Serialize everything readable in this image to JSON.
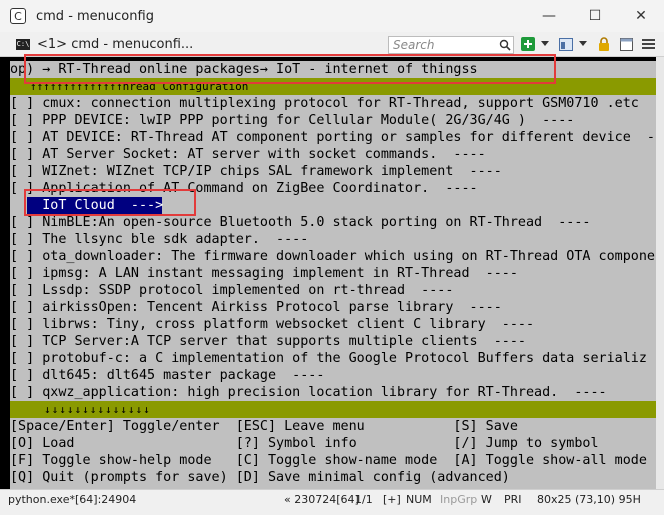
{
  "window": {
    "title": "cmd - menuconfig",
    "minimize_glyph": "—",
    "maximize_glyph": "☐",
    "close_glyph": "✕"
  },
  "tab": {
    "label": "<1> cmd - menuconfi...",
    "icon": "console-icon"
  },
  "search": {
    "placeholder": "Search"
  },
  "toolbar": {
    "icons": [
      "search-icon",
      "new-console-plus-icon",
      "dropdown-icon",
      "view-icon",
      "lock-icon",
      "window-layout-icon",
      "menu-icon"
    ]
  },
  "terminal": {
    "breadcrumb": "op) → RT-Thread online packages→ IoT - internet of thingss",
    "header_partial": "   ↑↑↑↑↑↑↑↑↑↑↑↑↑↑hread Configuration",
    "items": [
      "[ ] cmux: connection multiplexing protocol for RT-Thread, support GSM0710 .etc",
      "[ ] PPP DEVICE: lwIP PPP porting for Cellular Module( 2G/3G/4G )  ----",
      "[ ] AT DEVICE: RT-Thread AT component porting or samples for different device  -",
      "[ ] AT Server Socket: AT server with socket commands.  ----",
      "[ ] WIZnet: WIZnet TCP/IP chips SAL framework implement  ----",
      "[ ] Application of AT Command on ZigBee Coordinator.  ----",
      "    IoT Cloud  --->",
      "[ ] NimBLE:An open-source Bluetooth 5.0 stack porting on RT-Thread  ----",
      "[ ] The llsync ble sdk adapter.  ----",
      "[ ] ota_downloader: The firmware downloader which using on RT-Thread OTA compone",
      "[ ] ipmsg: A LAN instant messaging implement in RT-Thread  ----",
      "[ ] Lssdp: SSDP protocol implemented on rt-thread  ----",
      "[ ] airkissOpen: Tencent Airkiss Protocol parse library  ----",
      "[ ] librws: Tiny, cross platform websocket client C library  ----",
      "[ ] TCP Server:A TCP server that supports multiple clients  ----",
      "[ ] protobuf-c: a C implementation of the Google Protocol Buffers data serializ",
      "[ ] dlt645: dlt645 master package  ----",
      "[ ] qxwz_application: high precision location library for RT-Thread.  ----"
    ],
    "selected_index": 6,
    "scroll_down_arrows": "↓↓↓↓↓↓↓↓↓↓↓↓↓↓",
    "help_lines": [
      "[Space/Enter] Toggle/enter  [ESC] Leave menu           [S] Save",
      "[O] Load                    [?] Symbol info            [/] Jump to symbol",
      "[F] Toggle show-help mode   [C] Toggle show-name mode  [A] Toggle show-all mode",
      "[Q] Quit (prompts for save) [D] Save minimal config (advanced)"
    ]
  },
  "statusbar": {
    "process": "python.exe*[64]:24904",
    "pid": "« 230724[64]",
    "position": "1/1",
    "plus": "[+]",
    "num": "NUM",
    "inpgrp": "InpGrp",
    "w": "W",
    "pri": "PRI",
    "size": "80x25",
    "cursor": "(73,10) 95H"
  },
  "colors": {
    "terminal_bg": "#c0c0c0",
    "olive_bar": "#8a9a00",
    "selection": "#000080",
    "annotation_box": "#e23b3b"
  }
}
